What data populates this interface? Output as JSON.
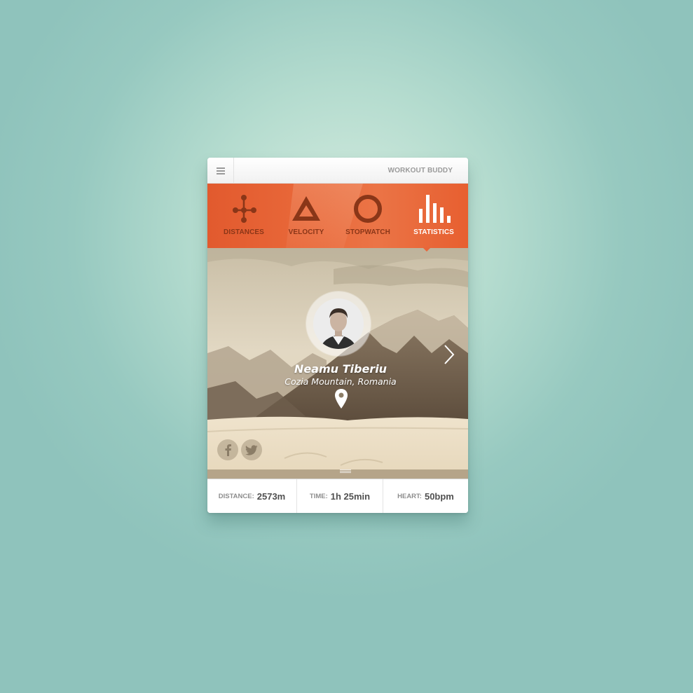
{
  "header": {
    "title": "WORKOUT BUDDY",
    "menu_icon": "hamburger-menu-icon"
  },
  "tabs": [
    {
      "label": "DISTANCES",
      "icon": "nodes-icon",
      "active": false
    },
    {
      "label": "VELOCITY",
      "icon": "triangle-icon",
      "active": false
    },
    {
      "label": "STOPWATCH",
      "icon": "circle-icon",
      "active": false
    },
    {
      "label": "STATISTICS",
      "icon": "bar-chart-icon",
      "active": true
    }
  ],
  "profile": {
    "name": "Neamu Tiberiu",
    "location": "Cozia Mountain, Romania"
  },
  "social": [
    "facebook-icon",
    "twitter-icon"
  ],
  "stats": [
    {
      "key": "DISTANCE:",
      "value": "2573m"
    },
    {
      "key": "TIME:",
      "value": "1h 25min"
    },
    {
      "key": "HEART:",
      "value": "50bpm"
    }
  ],
  "colors": {
    "accent": "#e8663a",
    "accent_dark": "#8a3618",
    "background": "#97c9c0",
    "stat_text": "#505050"
  }
}
